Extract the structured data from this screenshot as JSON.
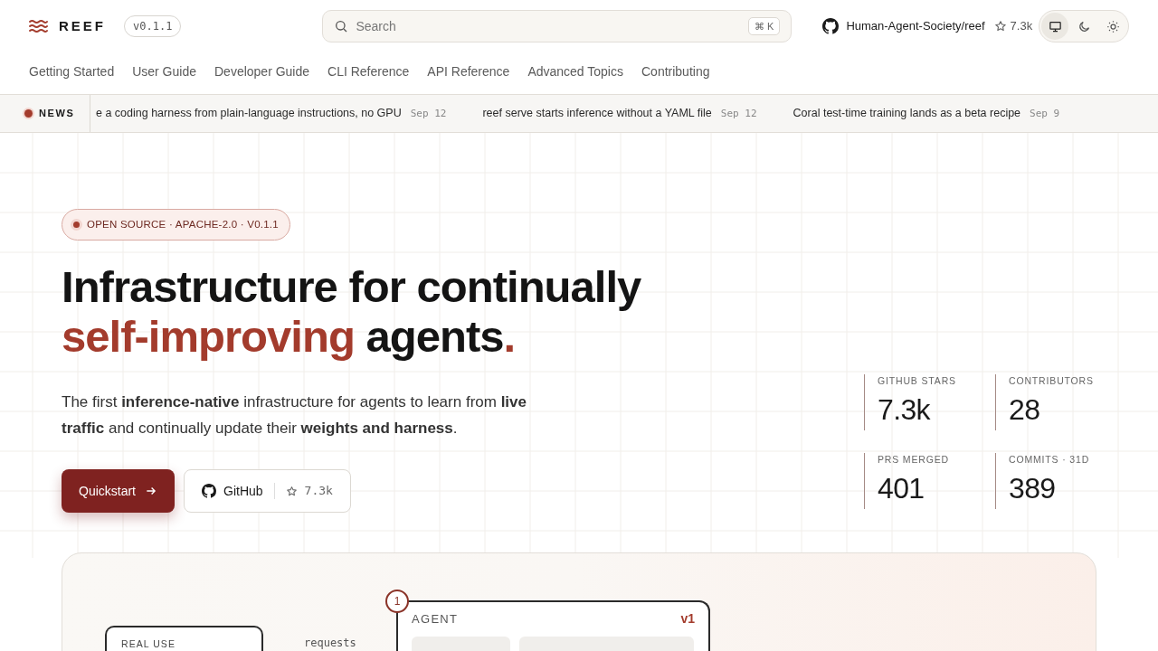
{
  "brand": {
    "name": "REEF",
    "version": "v0.1.1"
  },
  "search": {
    "placeholder": "Search",
    "shortcut": "⌘ K"
  },
  "repo": {
    "name": "Human-Agent-Society/reef",
    "stars": "7.3k"
  },
  "theme_toggle": [
    {
      "kind": "system",
      "selected": true
    },
    {
      "kind": "dark",
      "selected": false
    },
    {
      "kind": "light",
      "selected": false
    }
  ],
  "nav": [
    "Getting Started",
    "User Guide",
    "Developer Guide",
    "CLI Reference",
    "API Reference",
    "Advanced Topics",
    "Contributing"
  ],
  "news": {
    "label": "NEWS",
    "items": [
      {
        "text": "e a coding harness from plain-language instructions, no GPU",
        "date": "Sep 12"
      },
      {
        "text": "reef serve starts inference without a YAML file",
        "date": "Sep 12"
      },
      {
        "text": "Coral test-time training lands as a beta recipe",
        "date": "Sep 9"
      }
    ]
  },
  "hero": {
    "badge": "OPEN SOURCE · APACHE-2.0 · V0.1.1",
    "headline": {
      "line_1": "Infrastructure for continually",
      "accent": "self-improving",
      "rest": "agents",
      "period": "."
    },
    "lead": "The first **inference-native** infrastructure for agents to learn from **live traffic** and continually update their **weights and harness**.",
    "primary_button": "Quickstart",
    "github_button": {
      "label": "GitHub",
      "stars": "7.3k"
    }
  },
  "stats": [
    {
      "label": "GITHUB STARS",
      "value": "7.3k"
    },
    {
      "label": "CONTRIBUTORS",
      "value": "28"
    },
    {
      "label": "PRS MERGED",
      "value": "401"
    },
    {
      "label": "COMMITS · 31D",
      "value": "389"
    }
  ],
  "diagram": {
    "source_label": "REAL USE",
    "edge_label": "requests",
    "step": "1",
    "agent_label": "AGENT",
    "agent_version": "v1"
  }
}
